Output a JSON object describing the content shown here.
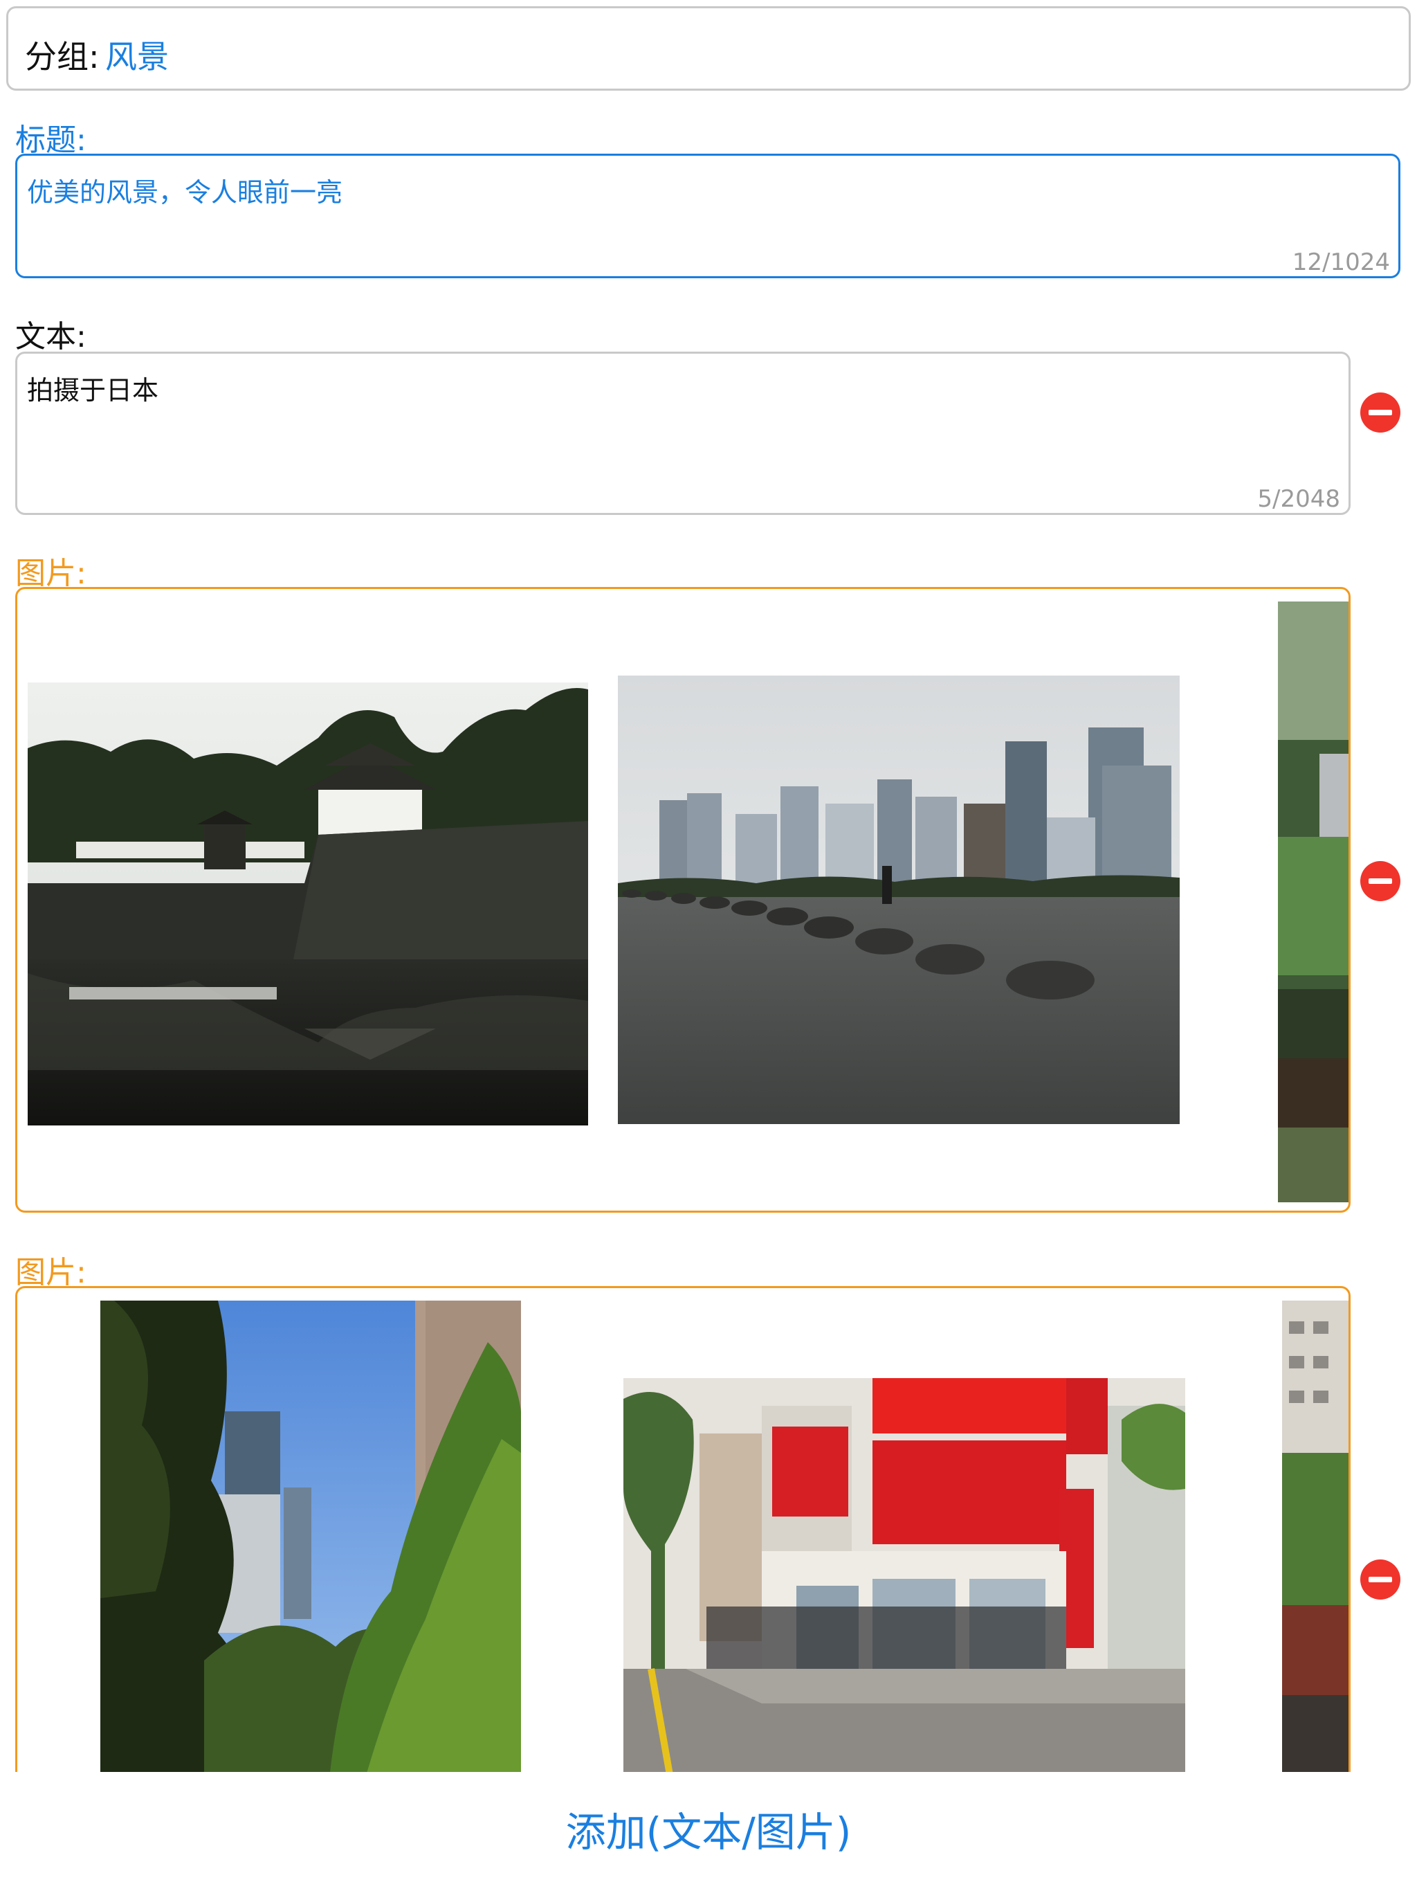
{
  "group": {
    "label": "分组:",
    "value": "风景"
  },
  "title_section": {
    "label": "标题:",
    "value": "优美的风景，令人眼前一亮",
    "counter": "12/1024"
  },
  "text_section": {
    "label": "文本:",
    "value": "拍摄于日本",
    "counter": "5/2048"
  },
  "image_sections": [
    {
      "label": "图片:",
      "images": [
        "castle-moat-photo",
        "city-skyline-stepping-stones-photo",
        "garden-photo-partial"
      ]
    },
    {
      "label": "图片:",
      "images": [
        "trees-building-photo",
        "espace-street-photo",
        "apartment-photo-partial"
      ]
    }
  ],
  "add_button": {
    "label": "添加(文本/图片)"
  },
  "colors": {
    "accent_blue": "#1a7fe0",
    "image_border_orange": "#f29a1f",
    "remove_red": "#f0342c",
    "border_gray": "#c9c9c9"
  },
  "icons": {
    "remove": "minus-circle-icon"
  }
}
